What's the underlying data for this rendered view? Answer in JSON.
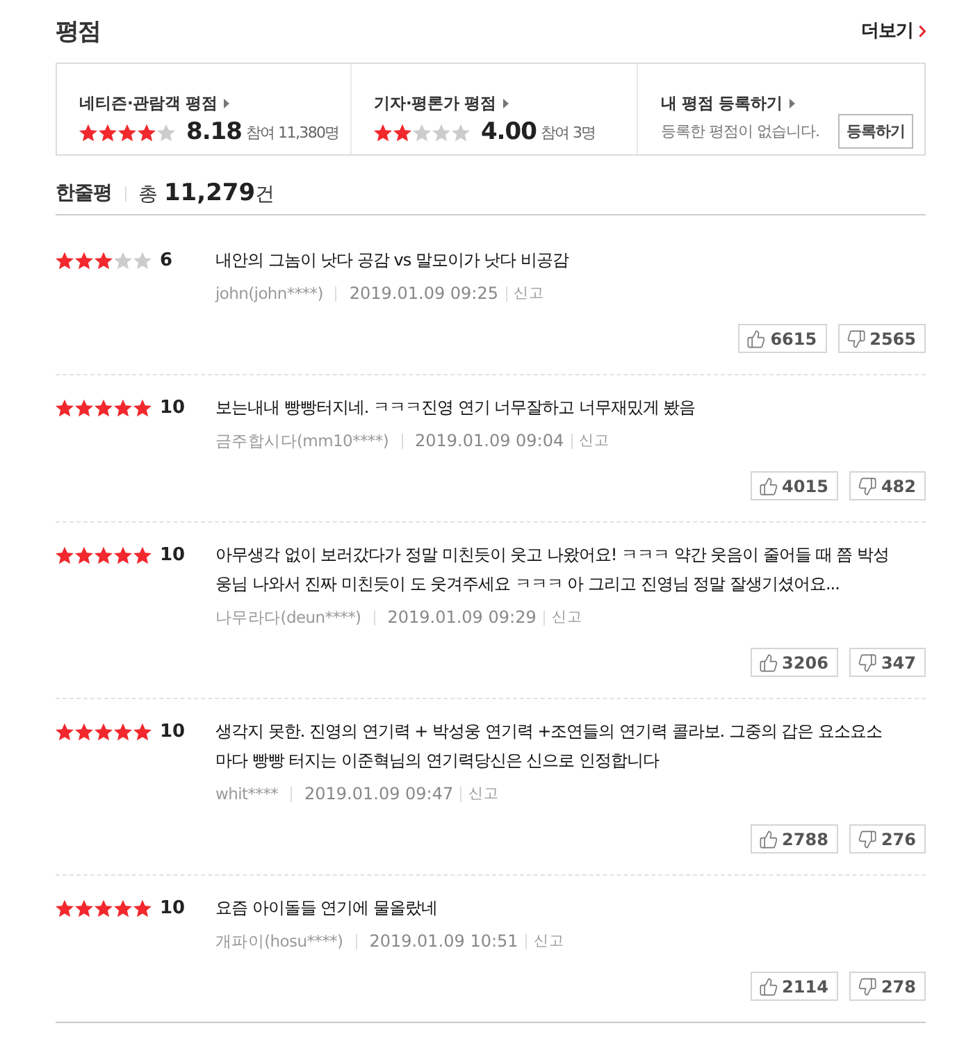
{
  "header": {
    "title": "평점",
    "more_link": "더보기"
  },
  "summary": [
    {
      "kind": "rating",
      "label": "네티즌·관람객 평점",
      "stars": 4,
      "score": "8.18",
      "participants": "참여 11,380명"
    },
    {
      "kind": "rating",
      "label": "기자·평론가 평점",
      "stars": 2,
      "score": "4.00",
      "participants": "참여 3명"
    },
    {
      "kind": "register",
      "label": "내 평점 등록하기",
      "message": "등록한 평점이 없습니다.",
      "button": "등록하기"
    }
  ],
  "comments_header": {
    "title": "한줄평",
    "total": "총 **11,279**건"
  },
  "reviews": [
    {
      "stars": 3,
      "score": "6",
      "text": "내안의 그놈이 낫다 공감 vs 말모이가 낫다 비공감",
      "author": "john(john****)",
      "date": "2019.01.09 09:25",
      "report": "신고",
      "likes": "6615",
      "dislikes": "2565"
    },
    {
      "stars": 5,
      "score": "10",
      "text": "보는내내 빵빵터지네. ㅋㅋㅋ진영 연기 너무잘하고 너무재밌게 봤음",
      "author": "금주합시다(mm10****)",
      "date": "2019.01.09 09:04",
      "report": "신고",
      "likes": "4015",
      "dislikes": "482"
    },
    {
      "stars": 5,
      "score": "10",
      "text": "아무생각 없이 보러갔다가 정말 미친듯이 웃고 나왔어요! ㅋㅋㅋ 약간 웃음이 줄어들 때 쯤 박성웅님 나와서 진짜 미친듯이 도 웃겨주세요 ㅋㅋㅋ 아 그리고 진영님 정말 잘생기셨어요...",
      "author": "나무라다(deun****)",
      "date": "2019.01.09 09:29",
      "report": "신고",
      "likes": "3206",
      "dislikes": "347"
    },
    {
      "stars": 5,
      "score": "10",
      "text": "생각지 못한. 진영의 연기력 + 박성웅 연기력 +조연들의 연기력 콜라보. 그중의 갑은 요소요소 마다 빵빵 터지는 이준혁님의 연기력당신은 신으로 인정합니다",
      "author": "whit****",
      "date": "2019.01.09 09:47",
      "report": "신고",
      "likes": "2788",
      "dislikes": "276"
    },
    {
      "stars": 5,
      "score": "10",
      "text": "요즘 아이돌들 연기에 물올랐네",
      "author": "개파이(hosu****)",
      "date": "2019.01.09 10:51",
      "report": "신고",
      "likes": "2114",
      "dislikes": "278"
    }
  ]
}
